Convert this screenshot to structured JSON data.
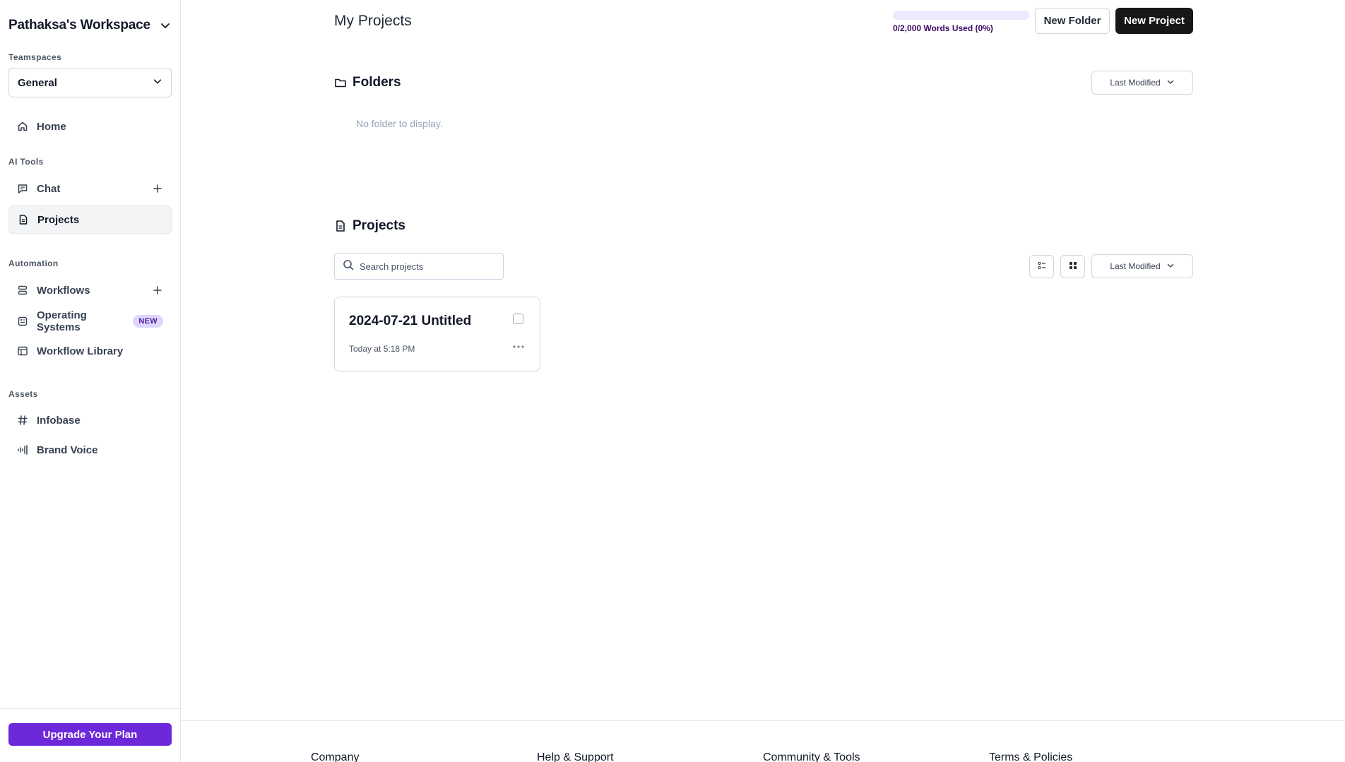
{
  "sidebar": {
    "workspace_title": "Pathaksa's Workspace",
    "teamspaces_label": "Teamspaces",
    "teamspace_selected": "General",
    "home_label": "Home",
    "ai_tools_label": "AI Tools",
    "chat_label": "Chat",
    "projects_label": "Projects",
    "automation_label": "Automation",
    "workflows_label": "Workflows",
    "operating_systems_label": "Operating Systems",
    "operating_systems_badge": "NEW",
    "workflow_library_label": "Workflow Library",
    "assets_label": "Assets",
    "infobase_label": "Infobase",
    "brand_voice_label": "Brand Voice",
    "upgrade_label": "Upgrade Your Plan"
  },
  "header": {
    "title": "My Projects",
    "usage_text": "0/2,000 Words Used (0%)",
    "usage_percent": 0,
    "new_folder_label": "New Folder",
    "new_project_label": "New Project"
  },
  "folders": {
    "title": "Folders",
    "sort_label": "Last Modified",
    "empty_text": "No folder to display."
  },
  "projects": {
    "title": "Projects",
    "search_placeholder": "Search projects",
    "sort_label": "Last Modified",
    "items": [
      {
        "title": "2024-07-21 Untitled",
        "date": "Today at 5:18 PM"
      }
    ]
  },
  "footer": {
    "columns": [
      "Company",
      "Help & Support",
      "Community & Tools",
      "Terms & Policies"
    ]
  },
  "colors": {
    "accent": "#6d28d9",
    "primary_button": "#171717"
  }
}
